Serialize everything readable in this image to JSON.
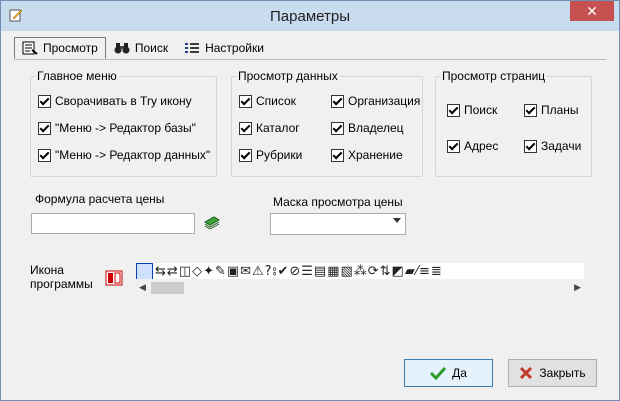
{
  "window": {
    "title": "Параметры",
    "close_glyph": "✕"
  },
  "tabs": [
    {
      "label": "Просмотр",
      "icon": "view-settings-icon",
      "active": true
    },
    {
      "label": "Поиск",
      "icon": "binoculars-icon",
      "active": false
    },
    {
      "label": "Настройки",
      "icon": "list-settings-icon",
      "active": false
    }
  ],
  "main_menu": {
    "title": "Главное меню",
    "items": [
      {
        "label": "Сворачивать в Try иконy",
        "checked": true
      },
      {
        "label": "\"Меню -> Редактор базы\"",
        "checked": true
      },
      {
        "label": "\"Меню -> Редактор данных\"",
        "checked": true
      }
    ]
  },
  "data_view": {
    "title": "Просмотр данных",
    "items": [
      {
        "label": "Список",
        "checked": true
      },
      {
        "label": "Организация",
        "checked": true
      },
      {
        "label": "Каталог",
        "checked": true
      },
      {
        "label": "Владелец",
        "checked": true
      },
      {
        "label": "Рубрики",
        "checked": true
      },
      {
        "label": "Хранение",
        "checked": true
      }
    ]
  },
  "page_view": {
    "title": "Просмотр страниц",
    "items": [
      {
        "label": "Поиск",
        "checked": true
      },
      {
        "label": "Планы",
        "checked": true
      },
      {
        "label": "Адрес",
        "checked": true
      },
      {
        "label": "Задачи",
        "checked": true
      }
    ]
  },
  "price_formula": {
    "label": "Формула расчета цены",
    "value": ""
  },
  "price_mask": {
    "label": "Маска просмотра цены",
    "value": ""
  },
  "program_icon": {
    "label_line1": "Икона",
    "label_line2": "программы"
  },
  "buttons": {
    "ok": "Да",
    "close": "Закрыть"
  },
  "colors": {
    "title_bar": "#c9dcef",
    "close_button": "#c75050",
    "ok_check": "#2a9d2a",
    "close_x": "#c0392b"
  }
}
